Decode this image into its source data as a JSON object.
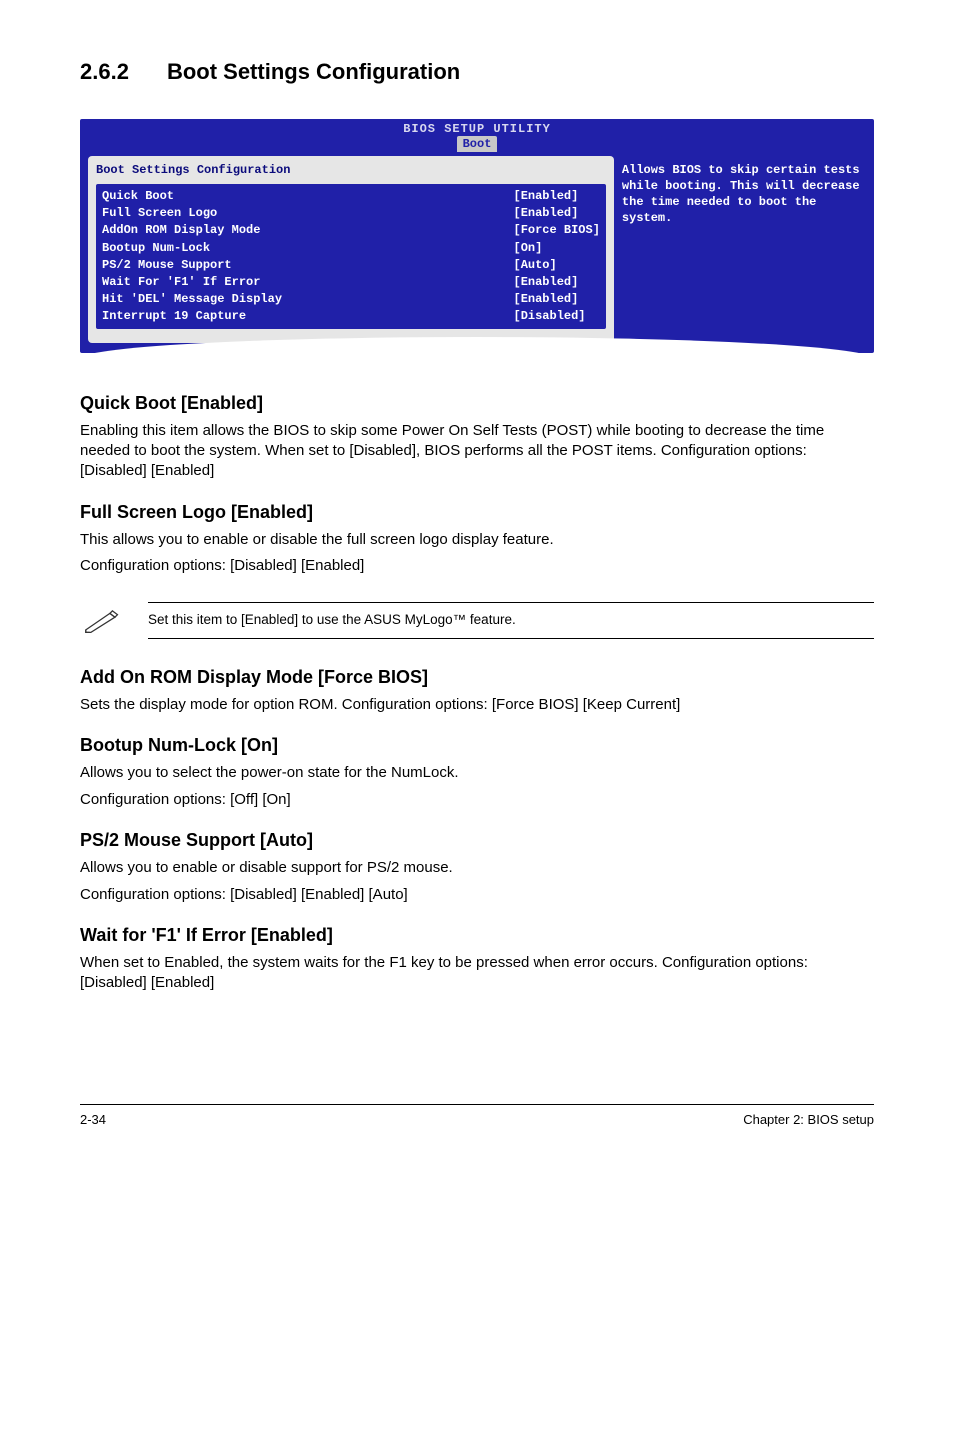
{
  "section": {
    "num": "2.6.2",
    "title": "Boot Settings Configuration"
  },
  "bios": {
    "utility_title": "BIOS SETUP UTILITY",
    "tab": "Boot",
    "panel_heading": "Boot Settings Configuration",
    "items": [
      {
        "label": "Quick Boot",
        "value": "[Enabled]",
        "selected": true
      },
      {
        "label": "Full Screen Logo",
        "value": "[Enabled]"
      },
      {
        "label": "AddOn ROM Display Mode",
        "value": "[Force BIOS]"
      },
      {
        "label": "Bootup Num-Lock",
        "value": "[On]"
      },
      {
        "label": "PS/2 Mouse Support",
        "value": "[Auto]"
      },
      {
        "label": "Wait For 'F1' If Error",
        "value": "[Enabled]"
      },
      {
        "label": "Hit 'DEL' Message Display",
        "value": "[Enabled]"
      },
      {
        "label": "Interrupt 19 Capture",
        "value": "[Disabled]"
      }
    ],
    "help": "Allows BIOS to skip certain tests while booting. This will decrease the time needed to boot the system."
  },
  "quick_boot": {
    "title": "Quick Boot [Enabled]",
    "body": "Enabling this item allows the BIOS to skip some Power On Self Tests (POST) while booting to decrease the time needed to boot the system. When set to [Disabled], BIOS performs all the POST items. Configuration options: [Disabled] [Enabled]"
  },
  "full_screen_logo": {
    "title": "Full Screen Logo [Enabled]",
    "body1": "This allows you to enable or disable the full screen logo display feature.",
    "body2": "Configuration options: [Disabled] [Enabled]"
  },
  "note": {
    "text": "Set this item to [Enabled] to use the ASUS MyLogo™ feature."
  },
  "add_on_rom": {
    "title": "Add On ROM Display Mode [Force BIOS]",
    "body": "Sets the display mode for option ROM.  Configuration options: [Force BIOS] [Keep Current]"
  },
  "bootup_numlock": {
    "title": "Bootup Num-Lock [On]",
    "body1": "Allows you to select the power-on state for the NumLock.",
    "body2": "Configuration options: [Off] [On]"
  },
  "ps2_mouse": {
    "title": "PS/2 Mouse Support [Auto]",
    "body1": "Allows you to enable or disable support for PS/2 mouse.",
    "body2": "Configuration options: [Disabled] [Enabled] [Auto]"
  },
  "wait_f1": {
    "title": "Wait for 'F1' If Error [Enabled]",
    "body": "When set to Enabled, the system waits for the F1 key to be pressed when error occurs. Configuration options: [Disabled] [Enabled]"
  },
  "footer": {
    "left": "2-34",
    "right": "Chapter 2: BIOS setup"
  }
}
